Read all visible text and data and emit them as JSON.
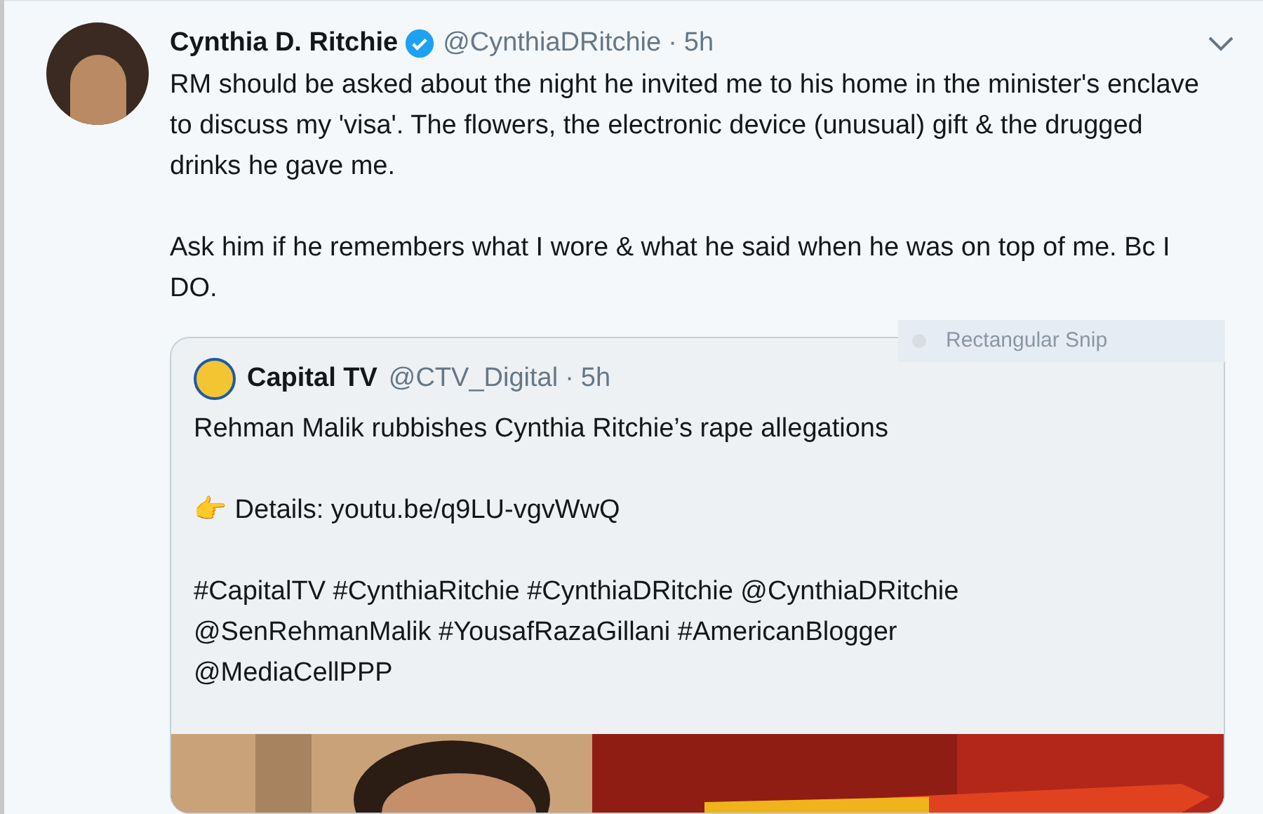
{
  "tweet": {
    "name": "Cynthia D. Ritchie",
    "verified": true,
    "handle": "@CynthiaDRitchie",
    "separator": "·",
    "time": "5h",
    "paragraphs": [
      "RM should be asked about the night he invited me to his home in the minister's enclave to discuss my 'visa'. The flowers, the electronic device (unusual) gift & the drugged drinks he gave me.",
      "Ask him if he remembers what I wore & what he said when he was on top of me. Bc I DO."
    ],
    "quote": {
      "name": "Capital TV",
      "handle": "@CTV_Digital",
      "separator": "·",
      "time": "5h",
      "paragraphs": [
        "Rehman Malik rubbishes Cynthia Ritchie’s rape allegations",
        "👉 Details: youtu.be/q9LU-vgvWwQ",
        "#CapitalTV #CynthiaRitchie #CynthiaDRitchie @CynthiaDRitchie @SenRehmanMalik #YousafRazaGillani #AmericanBlogger @MediaCellPPP"
      ]
    }
  },
  "tooltip": {
    "label": "Rectangular Snip"
  }
}
